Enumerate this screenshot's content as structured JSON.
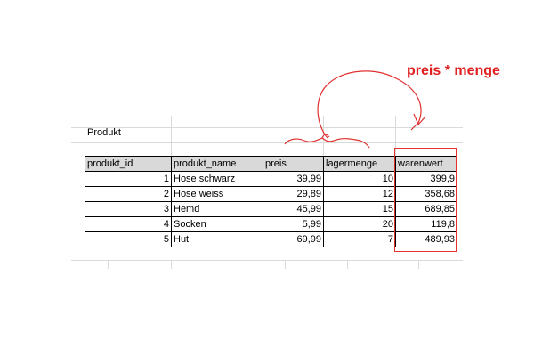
{
  "table_caption": "Produkt",
  "columns": [
    "produkt_id",
    "produkt_name",
    "preis",
    "lagermenge",
    "warenwert"
  ],
  "rows": [
    [
      "1",
      "Hose schwarz",
      "39,99",
      "10",
      "399,9"
    ],
    [
      "2",
      "Hose weiss",
      "29,89",
      "12",
      "358,68"
    ],
    [
      "3",
      "Hemd",
      "45,99",
      "15",
      "689,85"
    ],
    [
      "4",
      "Socken",
      "5,99",
      "20",
      "119,8"
    ],
    [
      "5",
      "Hut",
      "69,99",
      "7",
      "489,93"
    ]
  ],
  "annotation": {
    "formula": "preis * menge",
    "color": "#e02020"
  },
  "colors": {
    "header_fill": "#d9d9d9",
    "gridline": "#dadada",
    "annotation_red": "#e03030"
  }
}
